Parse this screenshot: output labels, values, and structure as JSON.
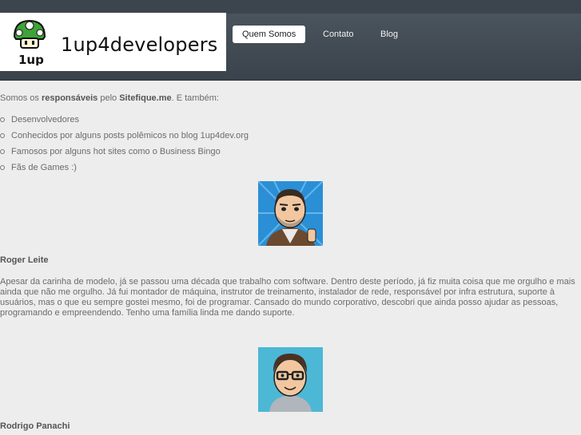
{
  "site": {
    "title": "1up4developers",
    "logo_icon": "1up-mushroom-logo-icon",
    "logo_caption": "1up"
  },
  "nav": {
    "items": [
      {
        "label": "Quem Somos",
        "active": true
      },
      {
        "label": "Contato",
        "active": false
      },
      {
        "label": "Blog",
        "active": false
      }
    ]
  },
  "intro": {
    "prefix": "Somos os ",
    "bold1": "responsáveis",
    "middle": " pelo ",
    "bold2": "Sitefique.me",
    "suffix": ". E também:"
  },
  "features": [
    "Desenvolvedores",
    "Conhecidos por alguns posts polêmicos no blog 1up4dev.org",
    "Famosos por alguns hot sites como o Business Bingo",
    "Fãs de Games :)"
  ],
  "people": [
    {
      "name": "Roger Leite",
      "avatar": "roger-avatar-icon",
      "bio": "Apesar da carinha de modelo, já se passou uma década que trabalho com software. Dentro deste período, já fiz muita coisa que me orgulho e mais ainda que não me orgulho. Já fui montador de máquina, instrutor de treinamento, instalador de rede, responsável por infra estrutura, suporte à usuários, mas o que eu sempre gostei mesmo, foi de programar. Cansado do mundo corporativo, descobri que ainda posso ajudar as pessoas, programando e empreendendo. Tenho uma família linda me dando suporte."
    },
    {
      "name": "Rodrigo Panachi",
      "avatar": "rodrigo-avatar-icon",
      "bio": ""
    }
  ],
  "colors": {
    "header_dark": "#3a434b",
    "page_bg": "#ededed",
    "text": "#6b6b6b",
    "mushroom_green": "#3fa33a"
  }
}
